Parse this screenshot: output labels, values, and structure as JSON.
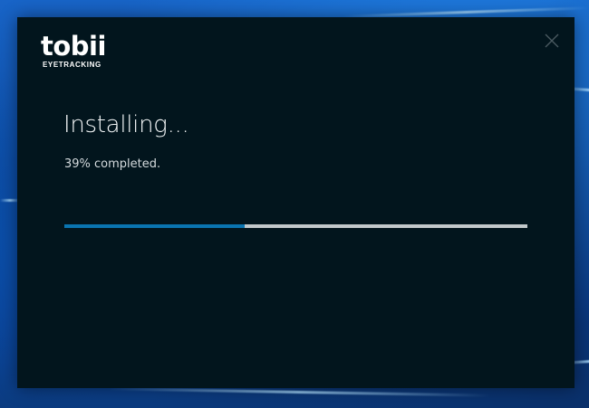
{
  "logo": {
    "wordmark": "tobii",
    "tagline": "EYETRACKING"
  },
  "installer": {
    "title": "Installing...",
    "status": "39% completed.",
    "progress": 0.39
  },
  "icons": {
    "close": "close-icon"
  },
  "colors": {
    "window_background": "#02151d",
    "progress_fill": "#0a74b0",
    "progress_track": "#c2c8ca",
    "desktop_accent": "#1864c7"
  }
}
